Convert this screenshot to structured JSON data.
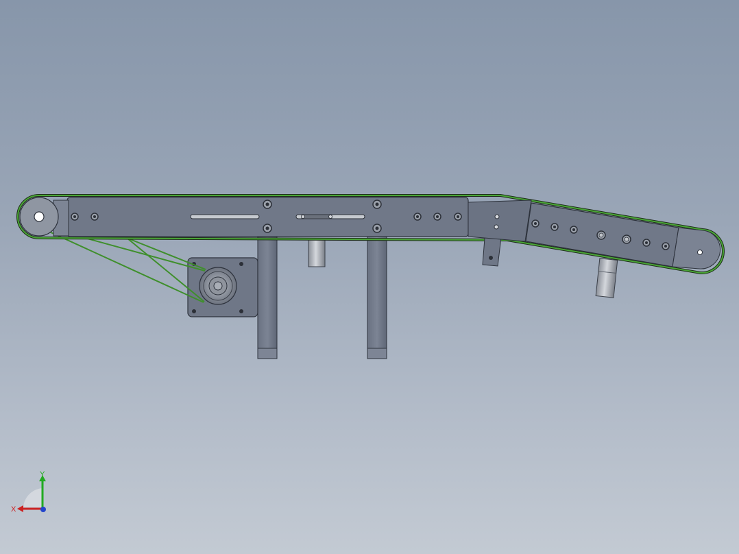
{
  "view": {
    "background_top": "#8796aa",
    "background_bottom": "#c3cad3"
  },
  "model": {
    "plate_color": "#707888",
    "plate_edge": "#2d323c",
    "belt_color": "#3f8f2c",
    "hole_color": "#2c3038",
    "roller_color": "#9ea4ae"
  },
  "triad": {
    "x_label": "X",
    "y_label": "Y",
    "x_color": "#cc2222",
    "y_color": "#22aa22",
    "z_color": "#2244cc"
  }
}
